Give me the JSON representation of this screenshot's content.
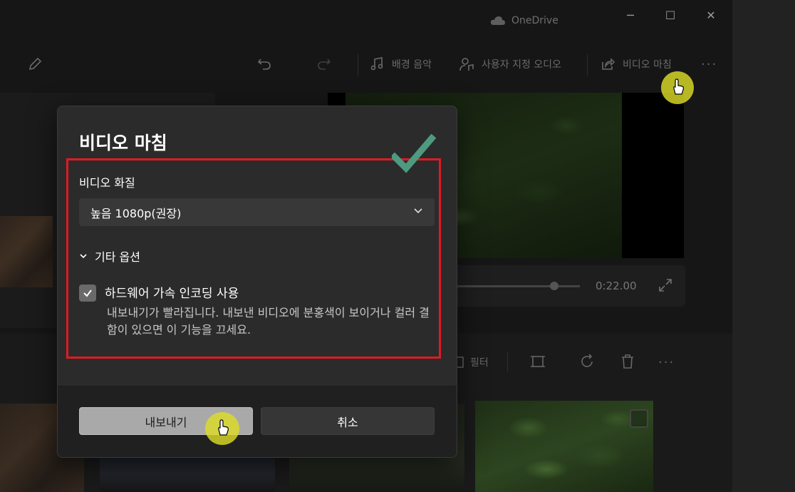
{
  "window": {
    "onedrive_label": "OneDrive",
    "controls": {
      "minimize": "─",
      "maximize": "☐",
      "close": "✕"
    }
  },
  "toolbar": {
    "background_music": "배경 음악",
    "custom_audio": "사용자 지정 오디오",
    "finish_video": "비디오 마침",
    "more": "···"
  },
  "player": {
    "time": "0:22.00"
  },
  "storyboard_tools": {
    "filter": "필터",
    "more": "···"
  },
  "dialog": {
    "title": "비디오 마침",
    "quality_label": "비디오 화질",
    "quality_value": "높음 1080p(권장)",
    "more_options": "기타 옵션",
    "hw_encoding_label": "하드웨어 가속 인코딩 사용",
    "hw_encoding_checked": true,
    "hw_encoding_desc": "내보내기가 빨라집니다. 내보낸 비디오에 분홍색이 보이거나 컬러 결함이 있으면 이 기능을 끄세요.",
    "export_button": "내보내기",
    "cancel_button": "취소"
  },
  "annotation_colors": {
    "highlight_box": "#e01a22",
    "check_mark": "#4e9a80",
    "cursor_highlight": "#dcdc28"
  }
}
